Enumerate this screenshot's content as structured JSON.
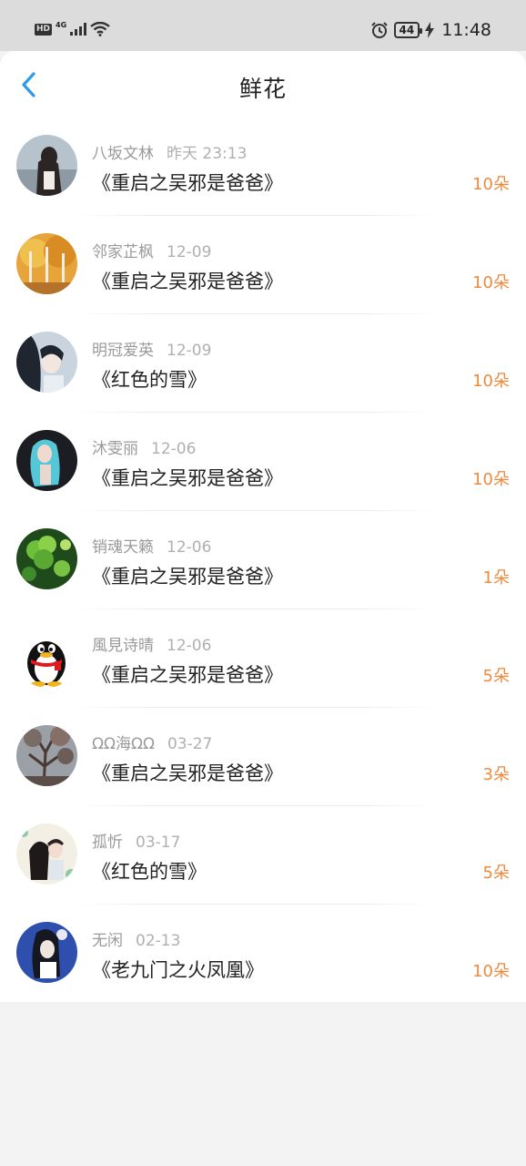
{
  "status_bar": {
    "hd": "HD",
    "network": "4G",
    "battery": "44",
    "time": "11:48"
  },
  "header": {
    "title": "鲜花"
  },
  "records": [
    {
      "user": "八坂文林",
      "date": "昨天 23:13",
      "book": "《重启之吴邪是爸爸》",
      "count": "10朵"
    },
    {
      "user": "邻家芷枫",
      "date": "12-09",
      "book": "《重启之吴邪是爸爸》",
      "count": "10朵"
    },
    {
      "user": "明冠爱英",
      "date": "12-09",
      "book": "《红色的雪》",
      "count": "10朵"
    },
    {
      "user": "沐雯丽",
      "date": "12-06",
      "book": "《重启之吴邪是爸爸》",
      "count": "10朵"
    },
    {
      "user": "销魂天籁",
      "date": "12-06",
      "book": "《重启之吴邪是爸爸》",
      "count": "1朵"
    },
    {
      "user": "風見诗晴",
      "date": "12-06",
      "book": "《重启之吴邪是爸爸》",
      "count": "5朵"
    },
    {
      "user": "ΩΩ海ΩΩ",
      "date": "03-27",
      "book": "《重启之吴邪是爸爸》",
      "count": "3朵"
    },
    {
      "user": "孤忻",
      "date": "03-17",
      "book": "《红色的雪》",
      "count": "5朵"
    },
    {
      "user": "无闲",
      "date": "02-13",
      "book": "《老九门之火凤凰》",
      "count": "10朵"
    }
  ],
  "colors": {
    "accent": "#2f9be6",
    "count": "#ef8a3c",
    "status_bar_bg": "#dcdcdc",
    "page_bg": "#f4f3f3"
  }
}
